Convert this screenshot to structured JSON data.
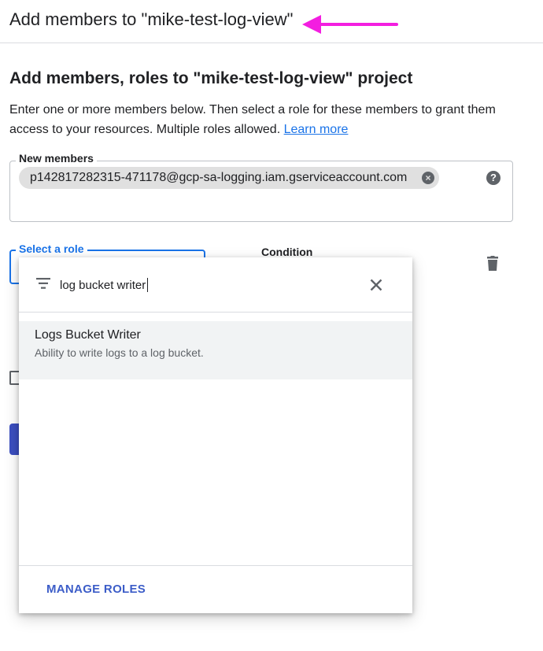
{
  "header": {
    "title": "Add members to \"mike-test-log-view\"",
    "annotation_arrow_color": "#f31ee0"
  },
  "section": {
    "title": "Add members, roles to \"mike-test-log-view\" project",
    "description": "Enter one or more members below. Then select a role for these members to grant them access to your resources. Multiple roles allowed.",
    "learn_more": "Learn more"
  },
  "new_members": {
    "label": "New members",
    "chips": [
      {
        "value": "p142817282315-471178@gcp-sa-logging.iam.gserviceaccount.com"
      }
    ],
    "help_icon": "help-icon"
  },
  "role": {
    "label": "Select a role",
    "condition_label": "Condition",
    "delete_icon": "trash-icon"
  },
  "role_dropdown": {
    "search_value": "log bucket writer",
    "filter_icon": "filter-icon",
    "clear_icon": "close-icon",
    "options": [
      {
        "title": "Logs Bucket Writer",
        "description": "Ability to write logs to a log bucket."
      }
    ],
    "manage_roles": "MANAGE ROLES"
  },
  "colors": {
    "accent": "#1a73e8",
    "primary_button": "#3c4fc0",
    "link": "#1a73e8"
  }
}
